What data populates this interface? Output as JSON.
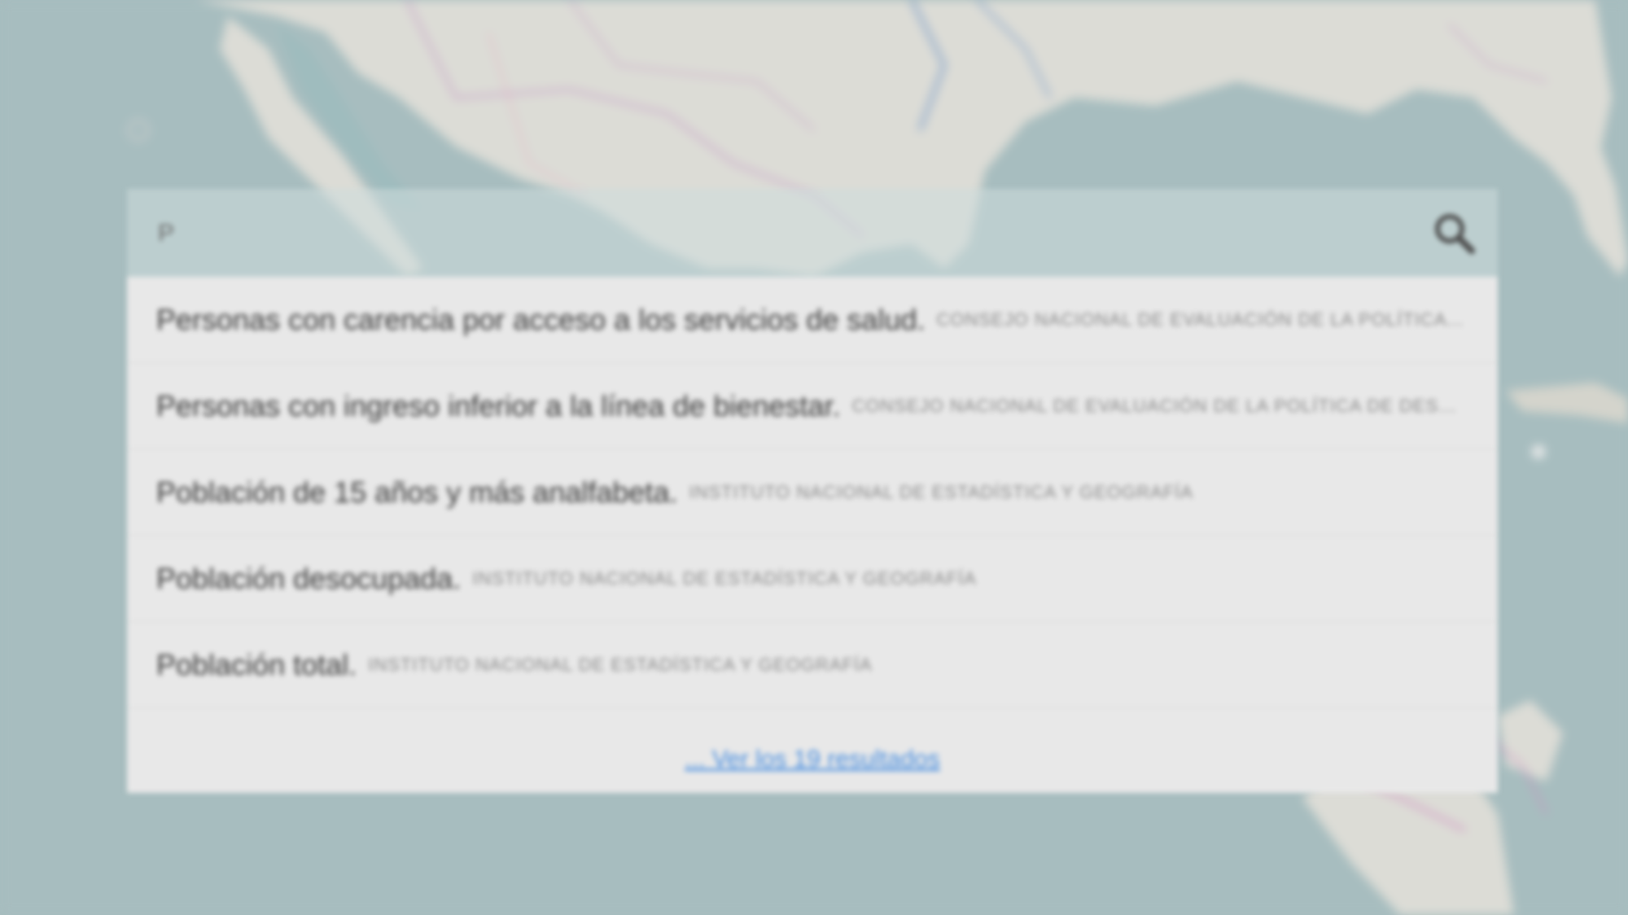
{
  "search": {
    "query": "",
    "placeholder": "P",
    "button_icon": "search-icon"
  },
  "results": [
    {
      "title": "Personas con carencia por acceso a los servicios de salud.",
      "source": "Consejo Nacional de Evaluación de la Política de Desarrollo Social"
    },
    {
      "title": "Personas con ingreso inferior a la línea de bienestar.",
      "source": "Consejo Nacional de Evaluación de la Política de Desarrollo Social"
    },
    {
      "title": "Población de 15 años y más analfabeta.",
      "source": "Instituto Nacional de Estadística y Geografía"
    },
    {
      "title": "Población desocupada.",
      "source": "Instituto Nacional de Estadística y Geografía"
    },
    {
      "title": "Población total.",
      "source": "Instituto Nacional de Estadística y Geografía"
    }
  ],
  "more_link": "... Ver los 19 resultados",
  "colors": {
    "ocean": "#a7bdbf",
    "land": "#dcdcd6",
    "panel_bg": "#e8e8e8",
    "link": "#4a8fe0"
  }
}
